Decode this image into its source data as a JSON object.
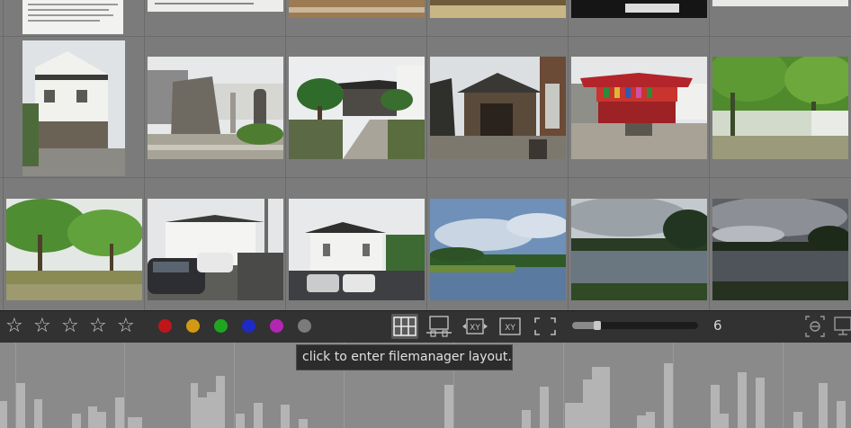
{
  "rating": {
    "stars": [
      "☆",
      "☆",
      "☆",
      "☆",
      "☆"
    ]
  },
  "color_labels": [
    "#c0161a",
    "#d29a14",
    "#1fa51f",
    "#1d2bc4",
    "#b326b5",
    "#7b7b7b"
  ],
  "layout_buttons": [
    "filemanager",
    "culling",
    "compare-xy",
    "compare-xy-fixed",
    "fullscreen-preview"
  ],
  "zoom": {
    "value": "6",
    "fraction": 0.2
  },
  "tooltip": {
    "text": "click to enter filemanager layout."
  },
  "thumbnails": [
    "document sign",
    "document sign",
    "wooden floor",
    "tatami room",
    "dark interior",
    "bright sky",
    "white storehouse",
    "stone monument",
    "garden path",
    "shrine gate",
    "red temple",
    "wisteria trellis",
    "green park",
    "white building",
    "museum building",
    "river landscape",
    "lake reflection",
    "cloudy lake"
  ]
}
